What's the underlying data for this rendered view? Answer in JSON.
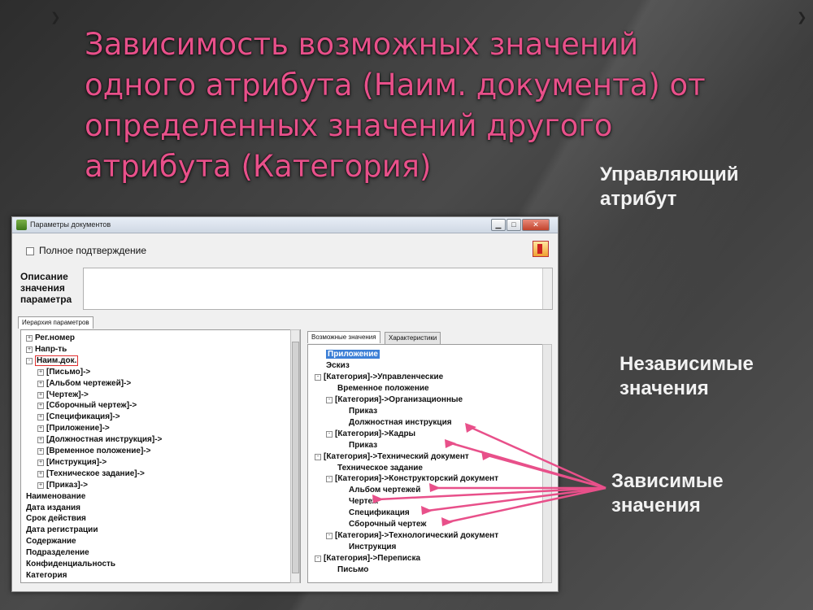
{
  "slide": {
    "title_lines": [
      "Зависимость возможных значений",
      "одного атрибута (Наим. документа) от",
      "определенных значений другого",
      "атрибута (Категория)"
    ],
    "label_control": [
      "Управляющий",
      "атрибут"
    ],
    "label_independent": [
      "Независимые",
      "значения"
    ],
    "label_dependent": [
      "Зависимые",
      "значения"
    ],
    "accent_color": "#e8508a"
  },
  "window": {
    "title": "Параметры документов",
    "btn_min": "▁",
    "btn_max": "□",
    "btn_close": "✕",
    "checkbox_label": "Полное подтверждение",
    "desc_label": [
      "Описание",
      "значения",
      "параметра"
    ],
    "left_tab": "Иерархия параметров",
    "right_tabs": [
      "Возможные значения",
      "Характеристики"
    ]
  },
  "left_tree": [
    {
      "text": "Рег.номер",
      "level": 0,
      "pm": "+"
    },
    {
      "text": "Напр-ть",
      "level": 0,
      "pm": "+"
    },
    {
      "text": "Наим.док.",
      "level": 0,
      "pm": "-",
      "boxed": true
    },
    {
      "text": "[Письмо]->",
      "level": 1,
      "pm": "+"
    },
    {
      "text": "[Альбом чертежей]->",
      "level": 1,
      "pm": "+"
    },
    {
      "text": "[Чертеж]->",
      "level": 1,
      "pm": "+"
    },
    {
      "text": "[Сборочный чертеж]->",
      "level": 1,
      "pm": "+"
    },
    {
      "text": "[Спецификация]->",
      "level": 1,
      "pm": "+"
    },
    {
      "text": "[Приложение]->",
      "level": 1,
      "pm": "+"
    },
    {
      "text": "[Должностная инструкция]->",
      "level": 1,
      "pm": "+"
    },
    {
      "text": "[Временное положение]->",
      "level": 1,
      "pm": "+"
    },
    {
      "text": "[Инструкция]->",
      "level": 1,
      "pm": "+"
    },
    {
      "text": "[Техническое задание]->",
      "level": 1,
      "pm": "+"
    },
    {
      "text": "[Приказ]->",
      "level": 1,
      "pm": "+"
    },
    {
      "text": "Наименование",
      "level": 0,
      "pm": ""
    },
    {
      "text": "Дата издания",
      "level": 0,
      "pm": ""
    },
    {
      "text": "Срок действия",
      "level": 0,
      "pm": ""
    },
    {
      "text": "Дата регистрации",
      "level": 0,
      "pm": ""
    },
    {
      "text": "Содержание",
      "level": 0,
      "pm": ""
    },
    {
      "text": "Подразделение",
      "level": 0,
      "pm": ""
    },
    {
      "text": "Конфиденциальность",
      "level": 0,
      "pm": ""
    },
    {
      "text": "Категория",
      "level": 0,
      "pm": ""
    }
  ],
  "right_tree": [
    {
      "text": "Приложение",
      "level": 1,
      "pm": "",
      "selected": true
    },
    {
      "text": "Эскиз",
      "level": 1,
      "pm": ""
    },
    {
      "text": "[Категория]->Управленческие",
      "level": 0,
      "pm": "-"
    },
    {
      "text": "Временное положение",
      "level": 2,
      "pm": ""
    },
    {
      "text": "[Категория]->Организационные",
      "level": 1,
      "pm": "-"
    },
    {
      "text": "Приказ",
      "level": 3,
      "pm": ""
    },
    {
      "text": "Должностная инструкция",
      "level": 3,
      "pm": ""
    },
    {
      "text": "[Категория]->Кадры",
      "level": 1,
      "pm": "-"
    },
    {
      "text": "Приказ",
      "level": 3,
      "pm": ""
    },
    {
      "text": "[Категория]->Технический документ",
      "level": 0,
      "pm": "-"
    },
    {
      "text": "Техническое задание",
      "level": 2,
      "pm": ""
    },
    {
      "text": "[Категория]->Конструкторский документ",
      "level": 1,
      "pm": "-"
    },
    {
      "text": "Альбом чертежей",
      "level": 3,
      "pm": ""
    },
    {
      "text": "Чертеж",
      "level": 3,
      "pm": ""
    },
    {
      "text": "Спецификация",
      "level": 3,
      "pm": ""
    },
    {
      "text": "Сборочный чертеж",
      "level": 3,
      "pm": ""
    },
    {
      "text": "[Категория]->Технологический документ",
      "level": 1,
      "pm": "-"
    },
    {
      "text": "Инструкция",
      "level": 3,
      "pm": ""
    },
    {
      "text": "[Категория]->Переписка",
      "level": 0,
      "pm": "-"
    },
    {
      "text": "Письмо",
      "level": 2,
      "pm": ""
    }
  ]
}
